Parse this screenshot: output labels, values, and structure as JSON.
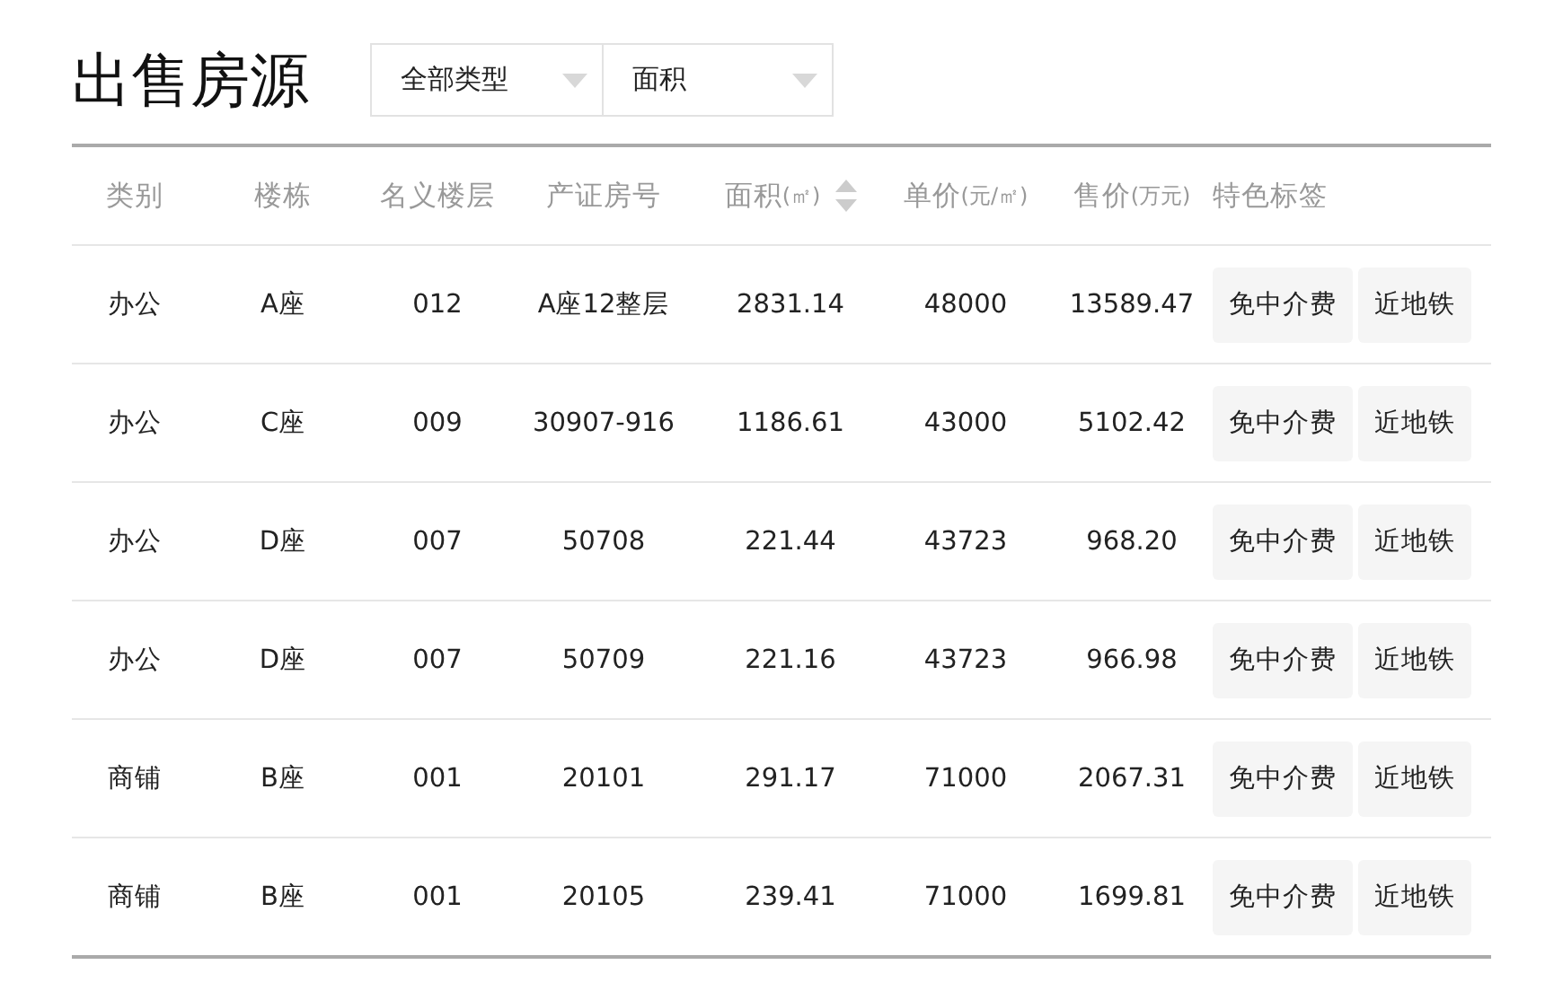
{
  "title": "出售房源",
  "filters": [
    {
      "value": "全部类型"
    },
    {
      "value": "面积"
    }
  ],
  "table": {
    "columns": [
      {
        "label": "类别",
        "kind": "plain"
      },
      {
        "label": "楼栋",
        "kind": "plain"
      },
      {
        "label": "名义楼层",
        "kind": "plain"
      },
      {
        "label": "产证房号",
        "kind": "plain"
      },
      {
        "label": "面积",
        "unit": "(㎡)",
        "kind": "sortable"
      },
      {
        "label": "单价",
        "unit": "(元/㎡)",
        "kind": "plain"
      },
      {
        "label": "售价",
        "unit": "(万元)",
        "kind": "plain"
      },
      {
        "label": "特色标签",
        "kind": "tags"
      }
    ],
    "rows": [
      {
        "cells": [
          "办公",
          "A座",
          "012",
          "A座12整层",
          "2831.14",
          "48000",
          "13589.47"
        ],
        "tags": [
          "免中介费",
          "近地铁"
        ]
      },
      {
        "cells": [
          "办公",
          "C座",
          "009",
          "30907-916",
          "1186.61",
          "43000",
          "5102.42"
        ],
        "tags": [
          "免中介费",
          "近地铁"
        ]
      },
      {
        "cells": [
          "办公",
          "D座",
          "007",
          "50708",
          "221.44",
          "43723",
          "968.20"
        ],
        "tags": [
          "免中介费",
          "近地铁"
        ]
      },
      {
        "cells": [
          "办公",
          "D座",
          "007",
          "50709",
          "221.16",
          "43723",
          "966.98"
        ],
        "tags": [
          "免中介费",
          "近地铁"
        ]
      },
      {
        "cells": [
          "商铺",
          "B座",
          "001",
          "20101",
          "291.17",
          "71000",
          "2067.31"
        ],
        "tags": [
          "免中介费",
          "近地铁"
        ]
      },
      {
        "cells": [
          "商铺",
          "B座",
          "001",
          "20105",
          "239.41",
          "71000",
          "1699.81"
        ],
        "tags": [
          "免中介费",
          "近地铁"
        ]
      }
    ]
  }
}
